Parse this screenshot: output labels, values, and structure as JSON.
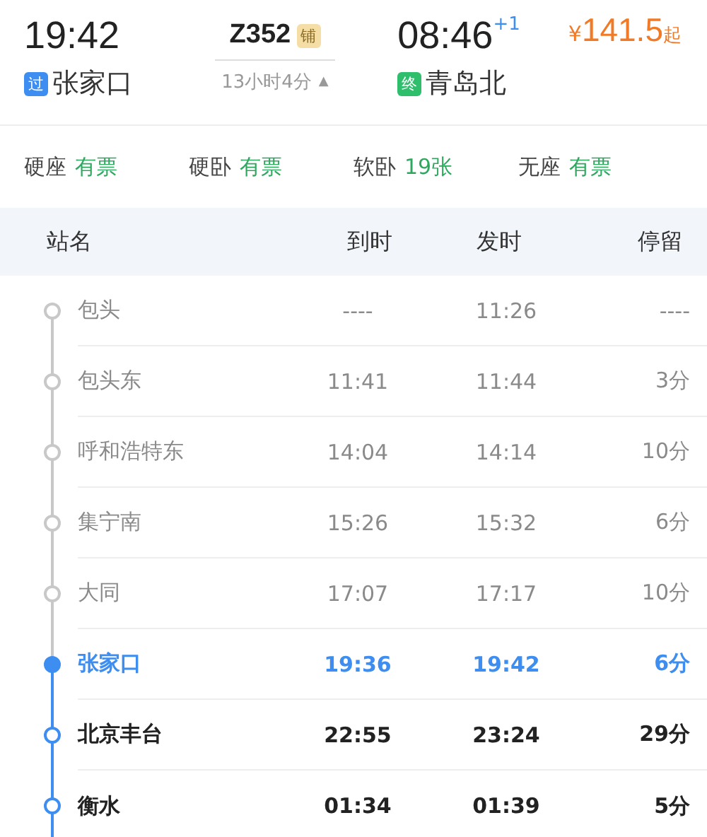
{
  "departure": {
    "time": "19:42",
    "badge": "过",
    "station": "张家口"
  },
  "train": {
    "number": "Z352",
    "badge": "铺",
    "duration": "13小时4分",
    "expand_icon": "▲"
  },
  "arrival": {
    "time": "08:46",
    "day_offset": "+1",
    "badge": "终",
    "station": "青岛北"
  },
  "price": {
    "currency": "¥",
    "amount": "141.5",
    "suffix": "起"
  },
  "seats": [
    {
      "name": "硬座",
      "availability": "有票"
    },
    {
      "name": "硬卧",
      "availability": "有票"
    },
    {
      "name": "软卧",
      "availability": "19张"
    },
    {
      "name": "无座",
      "availability": "有票"
    }
  ],
  "table": {
    "columns": [
      "站名",
      "到时",
      "发时",
      "停留"
    ],
    "rows": [
      {
        "kind": "passed",
        "station": "包头",
        "arrive": "----",
        "depart": "11:26",
        "stop": "----"
      },
      {
        "kind": "passed",
        "station": "包头东",
        "arrive": "11:41",
        "depart": "11:44",
        "stop": "3分"
      },
      {
        "kind": "passed",
        "station": "呼和浩特东",
        "arrive": "14:04",
        "depart": "14:14",
        "stop": "10分"
      },
      {
        "kind": "passed",
        "station": "集宁南",
        "arrive": "15:26",
        "depart": "15:32",
        "stop": "6分"
      },
      {
        "kind": "passed",
        "station": "大同",
        "arrive": "17:07",
        "depart": "17:17",
        "stop": "10分"
      },
      {
        "kind": "current",
        "station": "张家口",
        "arrive": "19:36",
        "depart": "19:42",
        "stop": "6分"
      },
      {
        "kind": "upcoming",
        "station": "北京丰台",
        "arrive": "22:55",
        "depart": "23:24",
        "stop": "29分"
      },
      {
        "kind": "upcoming",
        "station": "衡水",
        "arrive": "01:34",
        "depart": "01:39",
        "stop": "5分"
      }
    ]
  }
}
